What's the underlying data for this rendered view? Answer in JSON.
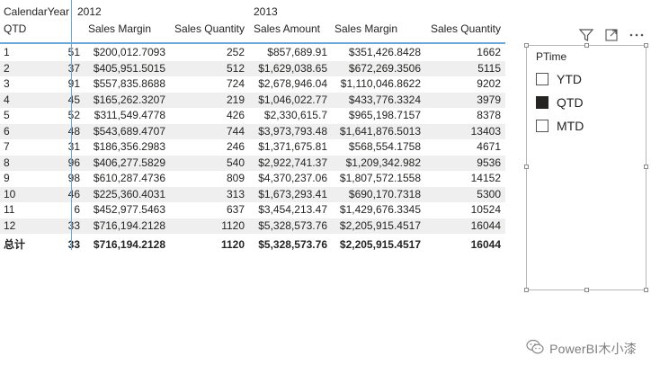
{
  "matrix": {
    "row_header_label": "CalendarYear",
    "row_field_label": "QTD",
    "years": [
      "2012",
      "2013"
    ],
    "columns_2012": [
      "Sales Margin",
      "Sales Quantity"
    ],
    "columns_2013": [
      "Sales Amount",
      "Sales Margin",
      "Sales Quantity"
    ],
    "rows": [
      {
        "qtd": "1",
        "cut": "51",
        "sm12": "$200,012.7093",
        "sq12": "252",
        "sa13": "$857,689.91",
        "sm13": "$351,426.8428",
        "sq13": "1662"
      },
      {
        "qtd": "2",
        "cut": "37",
        "sm12": "$405,951.5015",
        "sq12": "512",
        "sa13": "$1,629,038.65",
        "sm13": "$672,269.3506",
        "sq13": "5115"
      },
      {
        "qtd": "3",
        "cut": "91",
        "sm12": "$557,835.8688",
        "sq12": "724",
        "sa13": "$2,678,946.04",
        "sm13": "$1,110,046.8622",
        "sq13": "9202"
      },
      {
        "qtd": "4",
        "cut": "45",
        "sm12": "$165,262.3207",
        "sq12": "219",
        "sa13": "$1,046,022.77",
        "sm13": "$433,776.3324",
        "sq13": "3979"
      },
      {
        "qtd": "5",
        "cut": "52",
        "sm12": "$311,549.4778",
        "sq12": "426",
        "sa13": "$2,330,615.7",
        "sm13": "$965,198.7157",
        "sq13": "8378"
      },
      {
        "qtd": "6",
        "cut": "48",
        "sm12": "$543,689.4707",
        "sq12": "744",
        "sa13": "$3,973,793.48",
        "sm13": "$1,641,876.5013",
        "sq13": "13403"
      },
      {
        "qtd": "7",
        "cut": "31",
        "sm12": "$186,356.2983",
        "sq12": "246",
        "sa13": "$1,371,675.81",
        "sm13": "$568,554.1758",
        "sq13": "4671"
      },
      {
        "qtd": "8",
        "cut": "96",
        "sm12": "$406,277.5829",
        "sq12": "540",
        "sa13": "$2,922,741.37",
        "sm13": "$1,209,342.982",
        "sq13": "9536"
      },
      {
        "qtd": "9",
        "cut": "98",
        "sm12": "$610,287.4736",
        "sq12": "809",
        "sa13": "$4,370,237.06",
        "sm13": "$1,807,572.1558",
        "sq13": "14152"
      },
      {
        "qtd": "10",
        "cut": "46",
        "sm12": "$225,360.4031",
        "sq12": "313",
        "sa13": "$1,673,293.41",
        "sm13": "$690,170.7318",
        "sq13": "5300"
      },
      {
        "qtd": "11",
        "cut": "6",
        "sm12": "$452,977.5463",
        "sq12": "637",
        "sa13": "$3,454,213.47",
        "sm13": "$1,429,676.3345",
        "sq13": "10524"
      },
      {
        "qtd": "12",
        "cut": "33",
        "sm12": "$716,194.2128",
        "sq12": "1120",
        "sa13": "$5,328,573.76",
        "sm13": "$2,205,915.4517",
        "sq13": "16044"
      }
    ],
    "total": {
      "qtd": "总计",
      "cut": "33",
      "sm12": "$716,194.2128",
      "sq12": "1120",
      "sa13": "$5,328,573.76",
      "sm13": "$2,205,915.4517",
      "sq13": "16044"
    }
  },
  "slicer": {
    "title": "PTime",
    "items": [
      {
        "label": "YTD",
        "checked": false
      },
      {
        "label": "QTD",
        "checked": true
      },
      {
        "label": "MTD",
        "checked": false
      }
    ],
    "toolbar_icons": [
      "filter-icon",
      "focus-mode-icon",
      "more-options-icon"
    ]
  },
  "watermark": {
    "text": "PowerBI木小漆",
    "icon": "wechat-icon"
  },
  "colors": {
    "accent_line": "#6aa8d8",
    "row_shade": "#efefef",
    "slicer_border": "#b8b8b8"
  }
}
